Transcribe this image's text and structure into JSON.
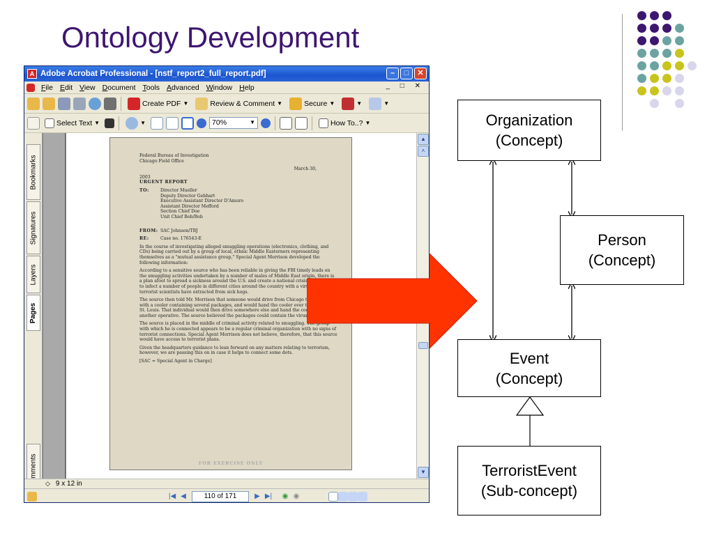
{
  "slide": {
    "title": "Ontology Development",
    "dot_colors": {
      "purple": "#3d1670",
      "teal": "#6ba3a1",
      "yellow": "#c8c41c",
      "lavender": "#d8d6ea"
    },
    "arrow_color": "#ff3300"
  },
  "acrobat": {
    "window_title": "Adobe Acrobat Professional - [nstf_report2_full_report.pdf]",
    "menu": [
      "File",
      "Edit",
      "View",
      "Document",
      "Tools",
      "Advanced",
      "Window",
      "Help"
    ],
    "toolbar1": {
      "create_pdf": "Create PDF",
      "review_comment": "Review & Comment",
      "secure": "Secure"
    },
    "toolbar2": {
      "select_text": "Select Text",
      "zoom": "70%",
      "how_to": "How To..?"
    },
    "nav_tabs": [
      "Bookmarks",
      "Signatures",
      "Layers",
      "Pages",
      "Comments"
    ],
    "page_size": "9 x 12 in",
    "page_indicator": "110 of 171",
    "document": {
      "header1": "Federal Bureau of Investigation",
      "header2": "Chicago Field Office",
      "date": "March 30,",
      "year": "2003",
      "urgent": "URGENT REPORT",
      "to_label": "TO:",
      "to_lines": [
        "Director Mueller",
        "Deputy Director Gebhart",
        "Executive Assistant Director D'Amuro",
        "Assistant Director Mefford",
        "Section Chief Doe",
        "Unit Chief Bob/Bob"
      ],
      "from_label": "FROM:",
      "from": "SAC Johnson/TBJ",
      "re_label": "RE:",
      "re": "Case no. 176543-E",
      "paragraphs": [
        "In the course of investigating alleged smuggling operations (electronics, clothing, and CDs) being carried out by a group of local, ethnic Middle Easterners representing themselves as a \"mutual assistance group,\" Special Agent Morrison developed the following information:",
        "According to a sensitive source who has been reliable in giving the FBI timely leads on the smuggling activities undertaken by a number of males of Middle East origin, there is a plan afoot to spread a sickness around the U.S. and create a national crisis. The idea is to infect a number of people in different cities around the country with a virus that terrorist scientists have extracted from sick hogs.",
        "The source then told Mr. Morrison that someone would drive from Chicago to St. Louis with a cooler containing several packages, and would hand the cooler over to someone in St. Louis. That individual would then drive somewhere else and hand the cooler to another operative. The source believed the packages could contain the virus.",
        "The source is placed in the middle of criminal activity related to smuggling. The group with which he is connected appears to be a regular criminal organization with no signs of terrorist connections. Special Agent Morrison does not believe, therefore, that this source would have access to terrorist plans.",
        "Given the headquarters guidance to lean forward on any matters relating to terrorism, however, we are passing this on in case it helps to connect some dots."
      ],
      "footnote": "[SAC = Special Agent in Charge]",
      "watermark": "FOR EXERCISE ONLY"
    }
  },
  "diagram": {
    "organization": {
      "name": "Organization",
      "kind": "(Concept)"
    },
    "person": {
      "name": "Person",
      "kind": "(Concept)"
    },
    "event": {
      "name": "Event",
      "kind": "(Concept)"
    },
    "terrorist_event": {
      "name": "TerroristEvent",
      "kind": "(Sub-concept)"
    }
  }
}
